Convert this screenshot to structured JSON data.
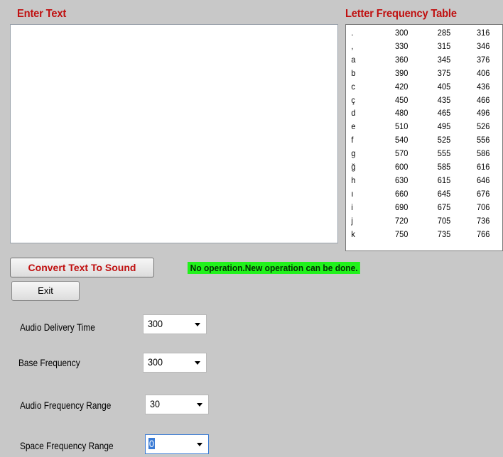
{
  "headings": {
    "enter_text": "Enter Text",
    "frequency_table": "Letter Frequency Table"
  },
  "text_input": {
    "value": ""
  },
  "frequency_table": {
    "rows": [
      [
        ".",
        "300",
        "285",
        "316"
      ],
      [
        ",",
        "330",
        "315",
        "346"
      ],
      [
        "a",
        "360",
        "345",
        "376"
      ],
      [
        "b",
        "390",
        "375",
        "406"
      ],
      [
        "c",
        "420",
        "405",
        "436"
      ],
      [
        "ç",
        "450",
        "435",
        "466"
      ],
      [
        "d",
        "480",
        "465",
        "496"
      ],
      [
        "e",
        "510",
        "495",
        "526"
      ],
      [
        "f",
        "540",
        "525",
        "556"
      ],
      [
        "g",
        "570",
        "555",
        "586"
      ],
      [
        "ğ",
        "600",
        "585",
        "616"
      ],
      [
        "h",
        "630",
        "615",
        "646"
      ],
      [
        "ı",
        "660",
        "645",
        "676"
      ],
      [
        "i",
        "690",
        "675",
        "706"
      ],
      [
        "j",
        "720",
        "705",
        "736"
      ],
      [
        "k",
        "750",
        "735",
        "766"
      ]
    ]
  },
  "buttons": {
    "convert": "Convert Text To Sound",
    "exit": "Exit"
  },
  "status": {
    "text": "No operation.New operation can be done.",
    "color": "#21f21b"
  },
  "settings": {
    "audio_delivery_time": {
      "label": "Audio Delivery Time",
      "value": "300"
    },
    "base_frequency": {
      "label": "Base Frequency",
      "value": "300"
    },
    "audio_frequency_range": {
      "label": "Audio Frequency Range",
      "value": "30"
    },
    "space_frequency_range": {
      "label": "Space Frequency Range",
      "value": "0"
    }
  },
  "colors": {
    "heading_red": "#c01010",
    "background": "#c8c8c8"
  }
}
